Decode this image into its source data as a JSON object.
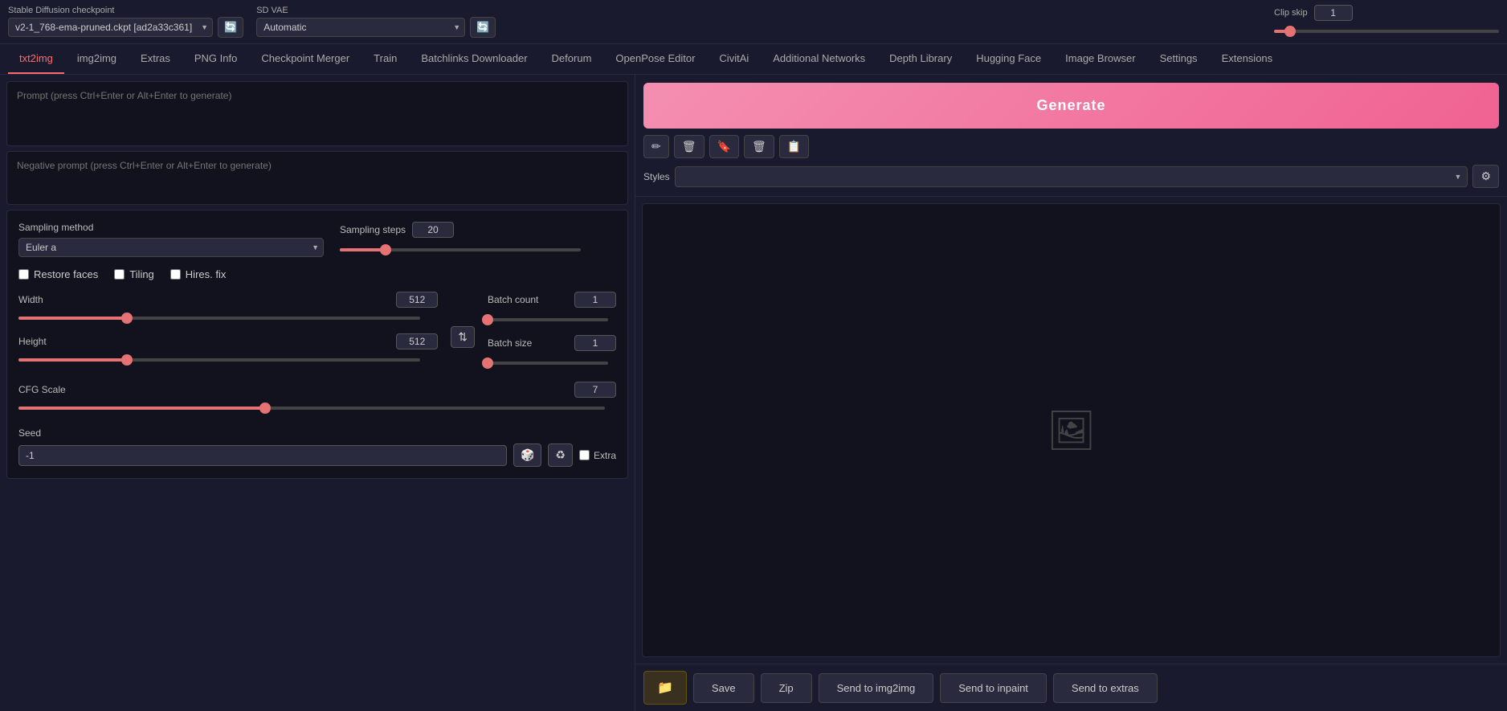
{
  "topbar": {
    "checkpoint_label": "Stable Diffusion checkpoint",
    "checkpoint_value": "v2-1_768-ema-pruned.ckpt [ad2a33c361]",
    "vae_label": "SD VAE",
    "vae_value": "Automatic",
    "clip_skip_label": "Clip skip",
    "clip_skip_value": "1",
    "clip_skip_percent": 7
  },
  "nav_tabs": [
    {
      "id": "txt2img",
      "label": "txt2img",
      "active": true
    },
    {
      "id": "img2img",
      "label": "img2img",
      "active": false
    },
    {
      "id": "extras",
      "label": "Extras",
      "active": false
    },
    {
      "id": "png-info",
      "label": "PNG Info",
      "active": false
    },
    {
      "id": "checkpoint-merger",
      "label": "Checkpoint Merger",
      "active": false
    },
    {
      "id": "train",
      "label": "Train",
      "active": false
    },
    {
      "id": "batchlinks",
      "label": "Batchlinks Downloader",
      "active": false
    },
    {
      "id": "deforum",
      "label": "Deforum",
      "active": false
    },
    {
      "id": "openpose",
      "label": "OpenPose Editor",
      "active": false
    },
    {
      "id": "civitai",
      "label": "CivitAi",
      "active": false
    },
    {
      "id": "additional-networks",
      "label": "Additional Networks",
      "active": false
    },
    {
      "id": "depth-library",
      "label": "Depth Library",
      "active": false
    },
    {
      "id": "hugging-face",
      "label": "Hugging Face",
      "active": false
    },
    {
      "id": "image-browser",
      "label": "Image Browser",
      "active": false
    },
    {
      "id": "settings",
      "label": "Settings",
      "active": false
    },
    {
      "id": "extensions",
      "label": "Extensions",
      "active": false
    }
  ],
  "prompts": {
    "positive_placeholder": "Prompt (press Ctrl+Enter or Alt+Enter to generate)",
    "negative_placeholder": "Negative prompt (press Ctrl+Enter or Alt+Enter to generate)"
  },
  "controls": {
    "sampling_method_label": "Sampling method",
    "sampling_method_value": "Euler a",
    "sampling_steps_label": "Sampling steps",
    "sampling_steps_value": "20",
    "sampling_steps_percent": 19,
    "restore_faces_label": "Restore faces",
    "tiling_label": "Tiling",
    "hires_fix_label": "Hires. fix",
    "width_label": "Width",
    "width_value": "512",
    "width_percent": 27,
    "height_label": "Height",
    "height_value": "512",
    "height_percent": 27,
    "batch_count_label": "Batch count",
    "batch_count_value": "1",
    "batch_count_percent": 0,
    "batch_size_label": "Batch size",
    "batch_size_value": "1",
    "batch_size_percent": 0,
    "cfg_scale_label": "CFG Scale",
    "cfg_scale_value": "7",
    "cfg_scale_percent": 42,
    "seed_label": "Seed",
    "seed_value": "-1",
    "extra_label": "Extra"
  },
  "right_panel": {
    "generate_label": "Generate",
    "styles_label": "Styles",
    "styles_placeholder": ""
  },
  "bottom_bar": {
    "folder_btn": "📁",
    "save_label": "Save",
    "zip_label": "Zip",
    "send_img2img_label": "Send to img2img",
    "send_inpaint_label": "Send to inpaint",
    "send_extras_label": "Send to extras"
  },
  "icons": {
    "refresh": "🔄",
    "settings": "⚙",
    "pencil": "✏",
    "trash": "🗑",
    "bookmark": "🔖",
    "paste": "📋",
    "image": "🖼",
    "dice": "🎲",
    "recycle": "♻",
    "swap": "⇅",
    "folder": "📁"
  }
}
